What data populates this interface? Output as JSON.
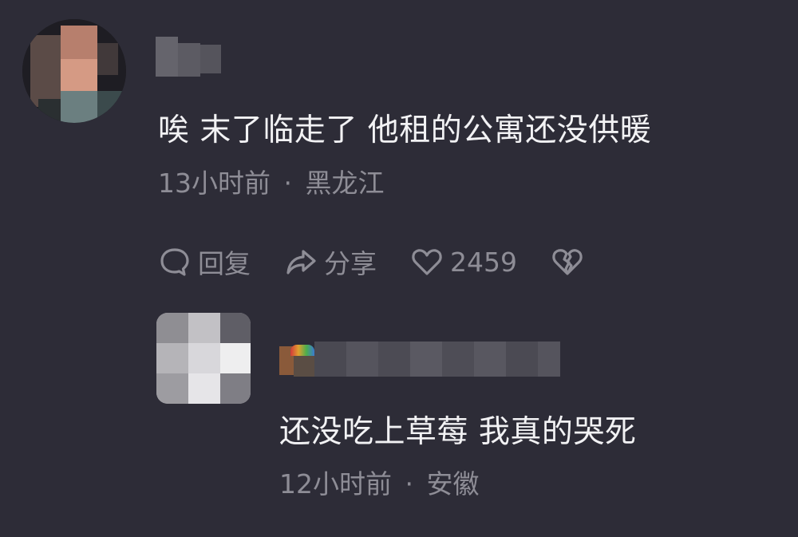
{
  "comment": {
    "text": "唉 末了临走了 他租的公寓还没供暖",
    "time": "13小时前",
    "separator": "·",
    "location": "黑龙江",
    "actions": {
      "reply_label": "回复",
      "share_label": "分享",
      "like_count": "2459"
    },
    "icons": [
      "comment-bubble-icon",
      "share-arrow-icon",
      "heart-icon",
      "broken-heart-icon"
    ]
  },
  "reply": {
    "text": "还没吃上草莓 我真的哭死",
    "time": "12小时前",
    "separator": "·",
    "location": "安徽"
  },
  "colors": {
    "background": "#2d2c37",
    "text_primary": "#f2f2f4",
    "text_secondary": "#8e8d96"
  }
}
